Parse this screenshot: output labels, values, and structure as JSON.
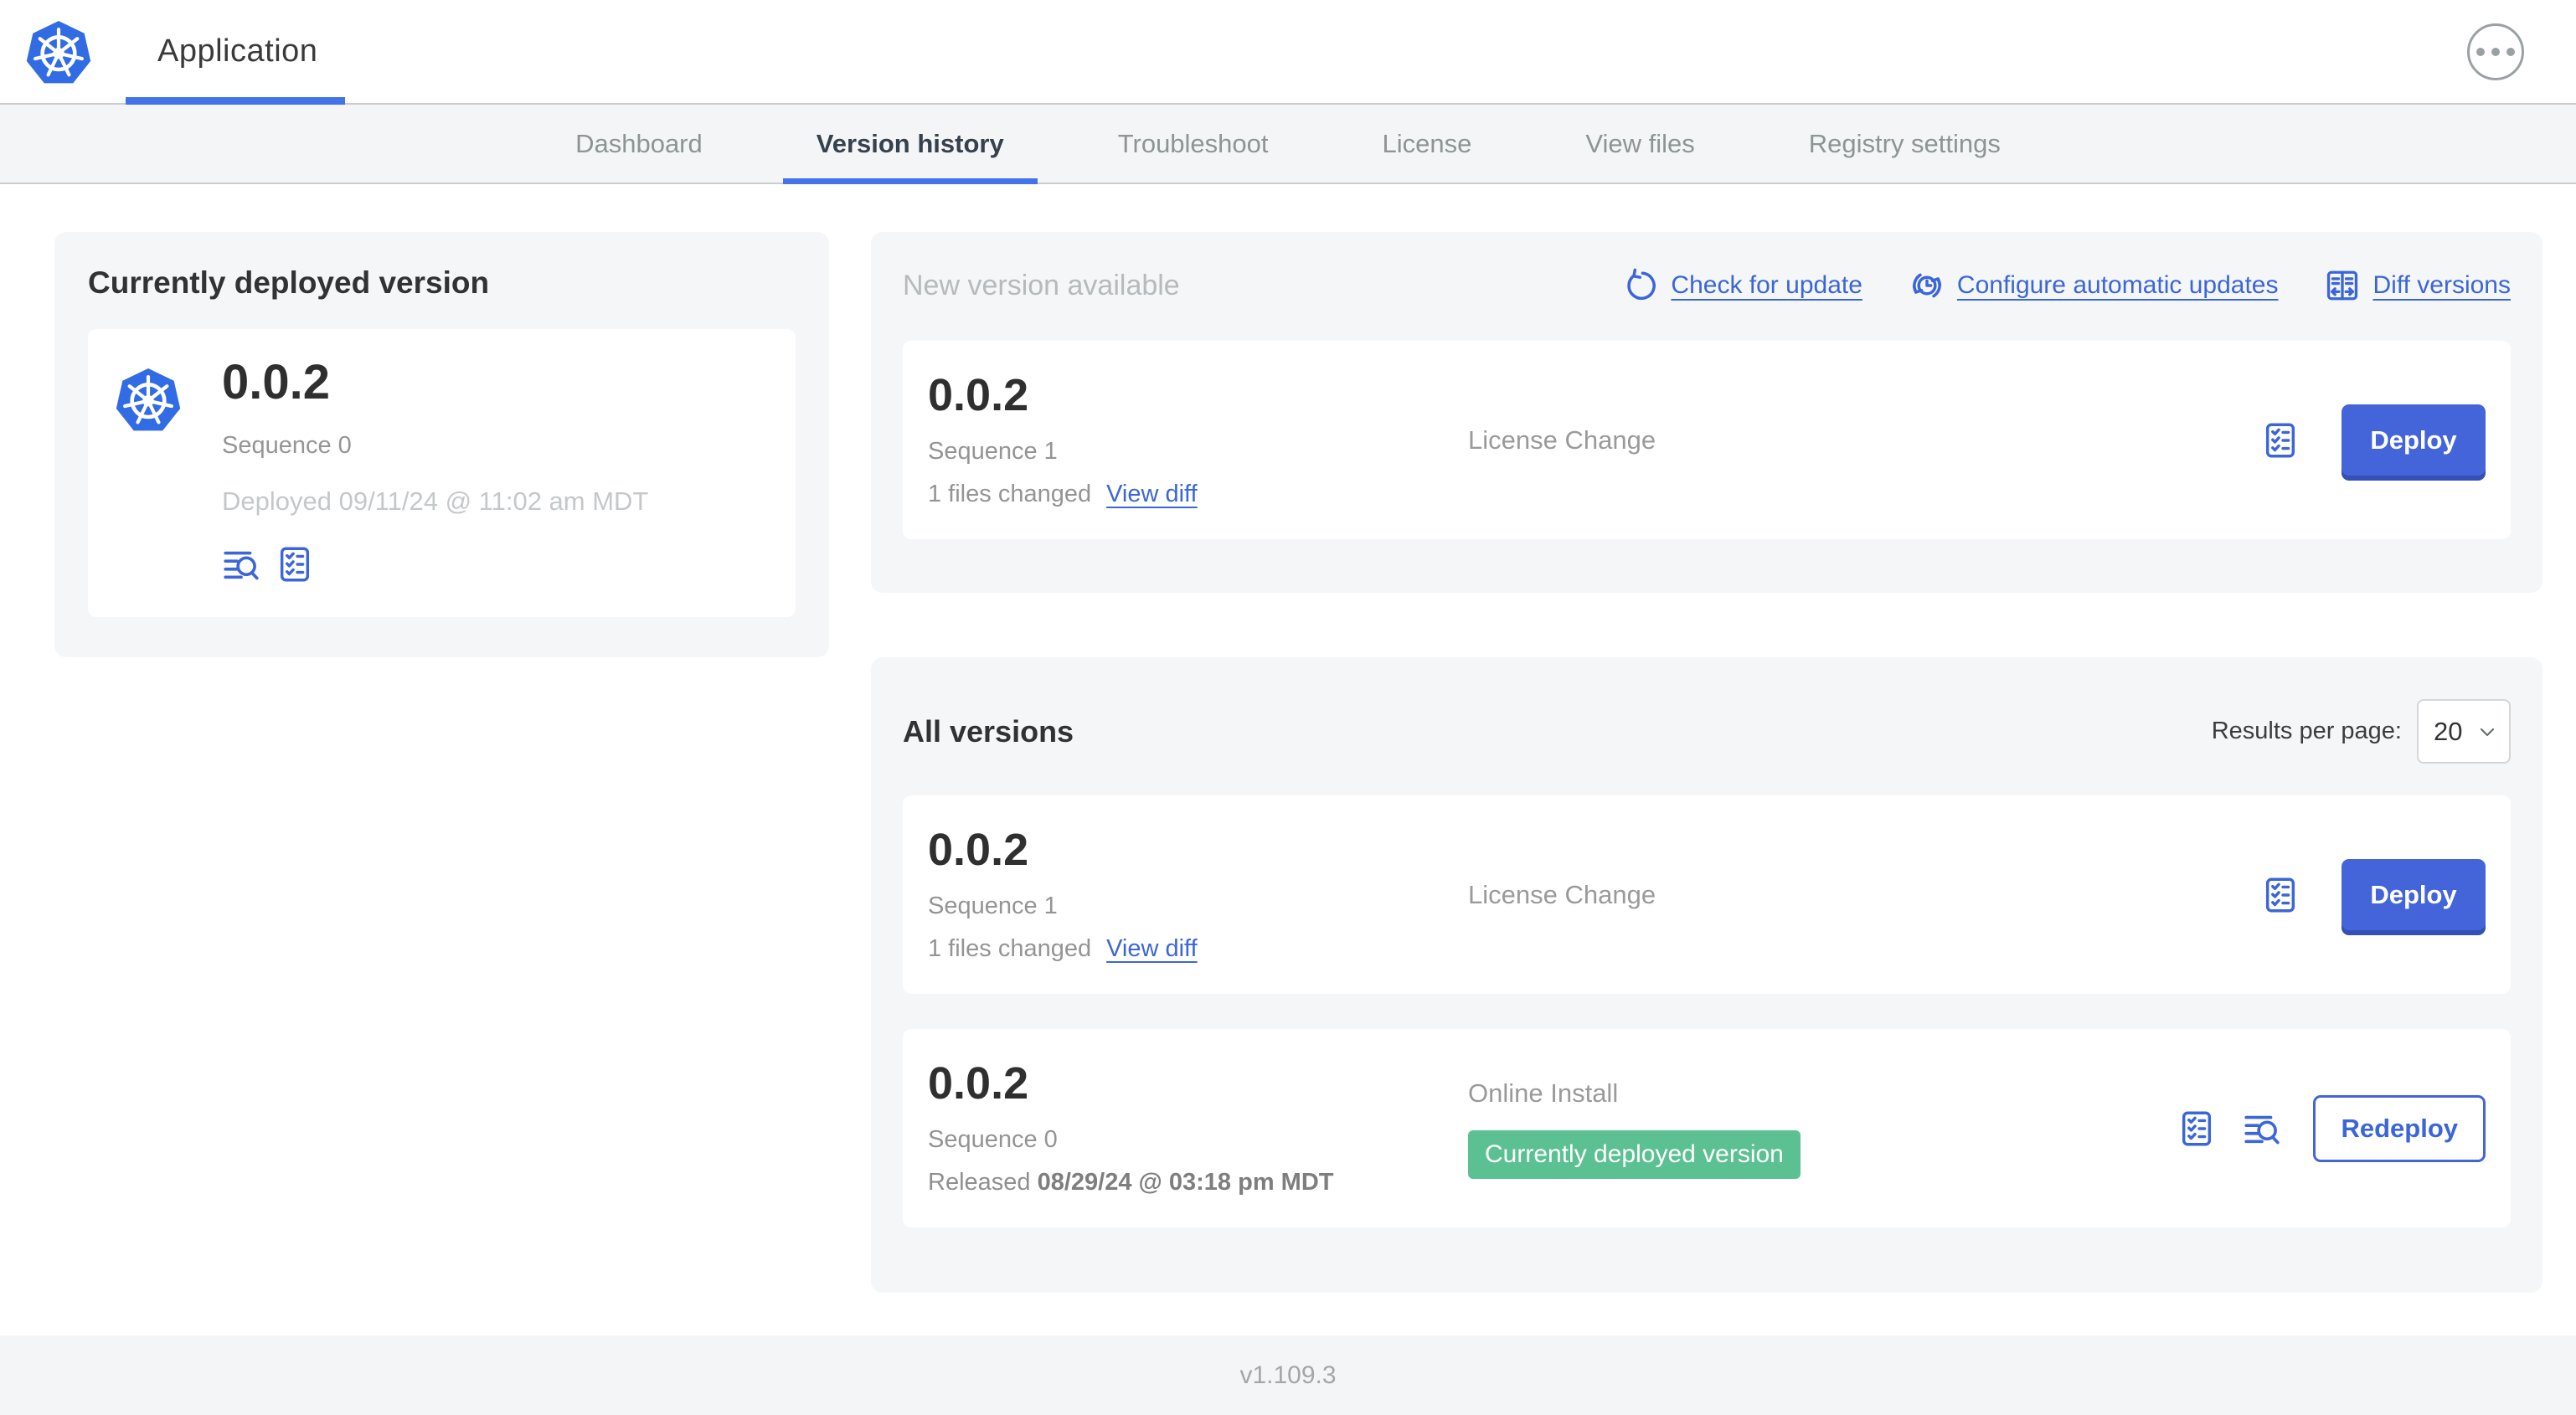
{
  "colors": {
    "accent_blue": "#3b66d9",
    "button_blue": "#4464d9",
    "badge_green": "#5cc192",
    "logo_blue": "#326ce5",
    "panel_gray": "#f5f6f8"
  },
  "icons": {
    "app_logo": "kubernetes-wheel",
    "menu": "ellipsis-circle",
    "check_update": "refresh-arrow",
    "configure_updates": "clock-refresh",
    "diff_versions": "split-diff",
    "preflight": "checklist",
    "logs": "log-search",
    "select_chevron": "chevron-down"
  },
  "header": {
    "title": "Application"
  },
  "nav": {
    "active_tab": "Version history",
    "tabs": [
      {
        "label": "Dashboard"
      },
      {
        "label": "Version history"
      },
      {
        "label": "Troubleshoot"
      },
      {
        "label": "License"
      },
      {
        "label": "View files"
      },
      {
        "label": "Registry settings"
      }
    ]
  },
  "current": {
    "title": "Currently deployed version",
    "version": "0.0.2",
    "sequence": "Sequence 0",
    "deployed": "Deployed 09/11/24 @ 11:02 am MDT"
  },
  "new_version": {
    "title": "New version available",
    "actions": {
      "check": "Check for update",
      "configure": "Configure automatic updates",
      "diff": "Diff versions"
    },
    "card": {
      "version": "0.0.2",
      "sequence": "Sequence 1",
      "files_changed": "1 files changed",
      "view_diff": "View diff",
      "source": "License Change",
      "deploy": "Deploy"
    }
  },
  "all_versions": {
    "title": "All versions",
    "results_label": "Results per page:",
    "results_value": "20",
    "rows": [
      {
        "version": "0.0.2",
        "sequence": "Sequence 1",
        "files_changed": "1 files changed",
        "view_diff": "View diff",
        "source": "License Change",
        "action": "Deploy"
      },
      {
        "version": "0.0.2",
        "sequence": "Sequence 0",
        "released_label": "Released",
        "released_value": "08/29/24 @ 03:18 pm MDT",
        "source": "Online Install",
        "badge": "Currently deployed version",
        "action": "Redeploy"
      }
    ]
  },
  "footer": {
    "version": "v1.109.3"
  }
}
